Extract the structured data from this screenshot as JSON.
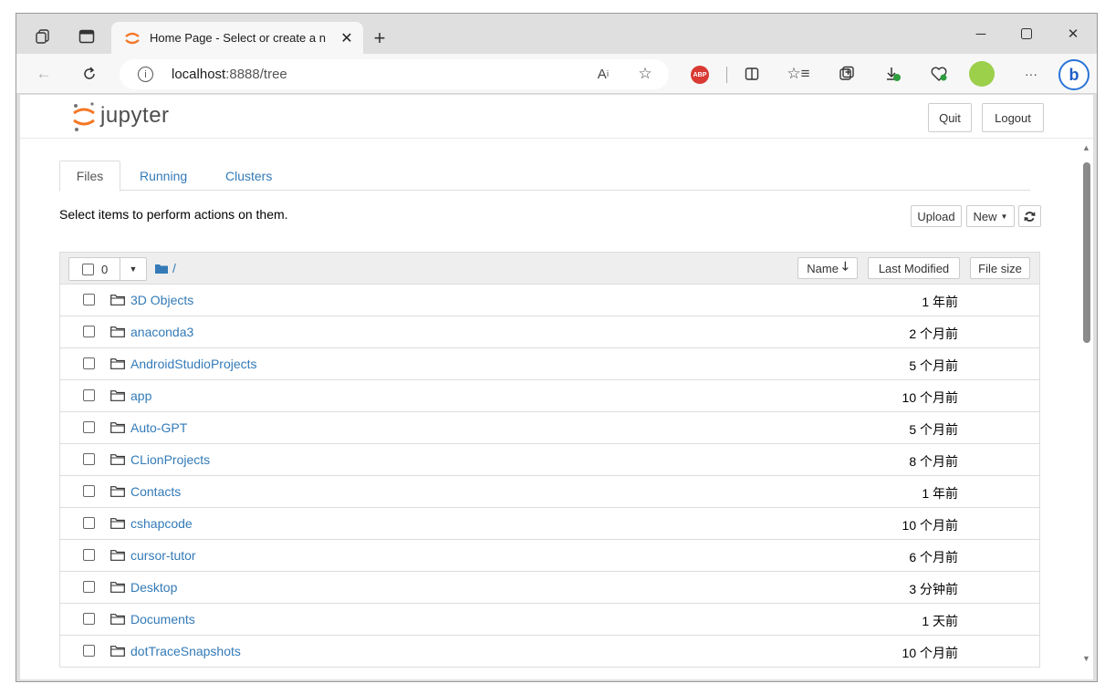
{
  "browser": {
    "tab_title": "Home Page - Select or create a n",
    "url_host": "localhost",
    "url_rest": ":8888/tree"
  },
  "jupyter": {
    "brand": "jupyter",
    "quit_label": "Quit",
    "logout_label": "Logout",
    "tabs": [
      "Files",
      "Running",
      "Clusters"
    ],
    "hint": "Select items to perform actions on them.",
    "upload_label": "Upload",
    "new_label": "New",
    "selected_count": "0",
    "breadcrumb": "/",
    "columns": {
      "name": "Name",
      "modified": "Last Modified",
      "size": "File size"
    },
    "files": [
      {
        "name": "3D Objects",
        "modified": "1 年前"
      },
      {
        "name": "anaconda3",
        "modified": "2 个月前"
      },
      {
        "name": "AndroidStudioProjects",
        "modified": "5 个月前"
      },
      {
        "name": "app",
        "modified": "10 个月前"
      },
      {
        "name": "Auto-GPT",
        "modified": "5 个月前"
      },
      {
        "name": "CLionProjects",
        "modified": "8 个月前"
      },
      {
        "name": "Contacts",
        "modified": "1 年前"
      },
      {
        "name": "cshapcode",
        "modified": "10 个月前"
      },
      {
        "name": "cursor-tutor",
        "modified": "6 个月前"
      },
      {
        "name": "Desktop",
        "modified": "3 分钟前"
      },
      {
        "name": "Documents",
        "modified": "1 天前"
      },
      {
        "name": "dotTraceSnapshots",
        "modified": "10 个月前"
      }
    ]
  },
  "colors": {
    "link": "#337ab7",
    "jupyter_orange": "#f37726",
    "abp_red": "#d93a33"
  }
}
